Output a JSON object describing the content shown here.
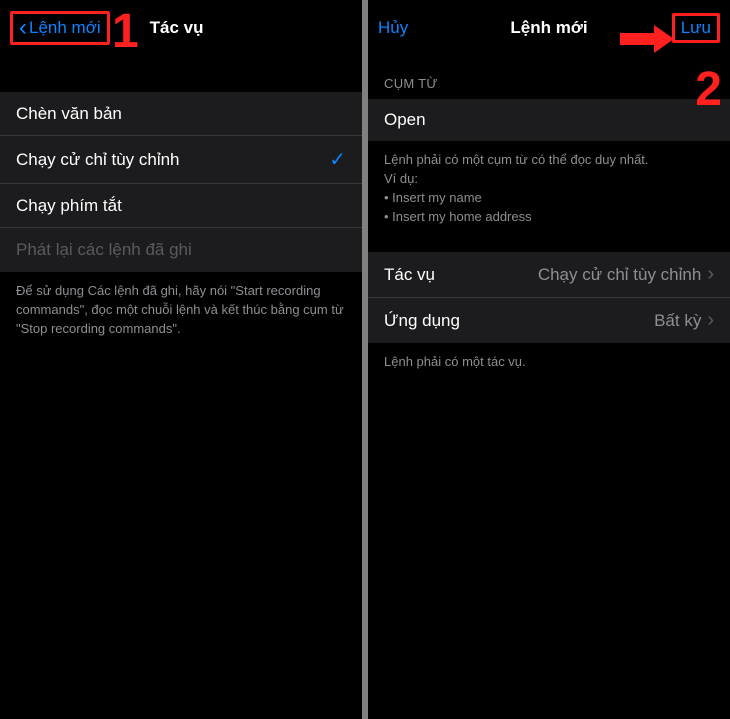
{
  "left": {
    "back_label": "Lệnh mới",
    "title": "Tác vụ",
    "step": "1",
    "rows": {
      "insert_text": "Chèn văn bản",
      "run_gesture": "Chạy cử chỉ tùy chỉnh",
      "run_shortcut": "Chạy phím tắt",
      "playback": "Phát lại các lệnh đã ghi"
    },
    "footer": "Để sử dụng Các lệnh đã ghi, hãy nói \"Start recording commands\", đọc một chuỗi lệnh và kết thúc bằng cụm từ \"Stop recording commands\"."
  },
  "right": {
    "cancel": "Hủy",
    "title": "Lệnh mới",
    "save": "Lưu",
    "step": "2",
    "phrase_header": "CỤM TỪ",
    "phrase_value": "Open",
    "phrase_footer_line1": "Lệnh phải có một cụm từ có thể đọc duy nhất.",
    "phrase_footer_line2": "Ví dụ:",
    "phrase_example1": "• Insert my name",
    "phrase_example2": "• Insert my home address",
    "action_label": "Tác vụ",
    "action_value": "Chạy cử chỉ tùy chỉnh",
    "app_label": "Ứng dụng",
    "app_value": "Bất kỳ",
    "action_footer": "Lệnh phải có một tác vụ."
  }
}
